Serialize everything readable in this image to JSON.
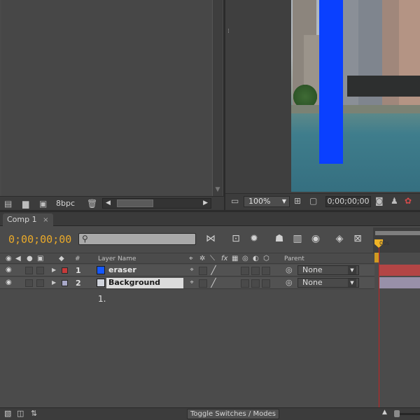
{
  "project_panel": {
    "bit_depth": "8bpc"
  },
  "viewer": {
    "zoom": "100%",
    "timecode": "0;00;00;00"
  },
  "timeline": {
    "tab_label": "Comp 1",
    "tab_close": "×",
    "current_time": "0;00;00;00",
    "search_value": "",
    "ruler_label": "00s",
    "columns": {
      "num": "#",
      "layer_name": "Layer Name",
      "parent": "Parent"
    },
    "layers": [
      {
        "num": "1",
        "name": "eraser",
        "label_color": "#c63a3a",
        "source_color": "#1558ff",
        "parent": "None",
        "bar_color": "#b34545"
      },
      {
        "num": "2",
        "name": "Background",
        "label_color": "#a8a8c8",
        "source_color": "#d0d4dc",
        "parent": "None",
        "bar_color": "#9890a8"
      }
    ],
    "annotation": "1.",
    "toggle_label": "Toggle Switches / Modes"
  },
  "colors": {
    "timecode": "#e9a92a",
    "cti": "#c42323",
    "solid_blue": "#0a40ff"
  },
  "icons": {
    "eye": "eye-icon",
    "audio": "speaker-icon",
    "solo": "solo-icon",
    "lock": "lock-icon",
    "label": "label-tag-icon",
    "search": "search-icon"
  }
}
